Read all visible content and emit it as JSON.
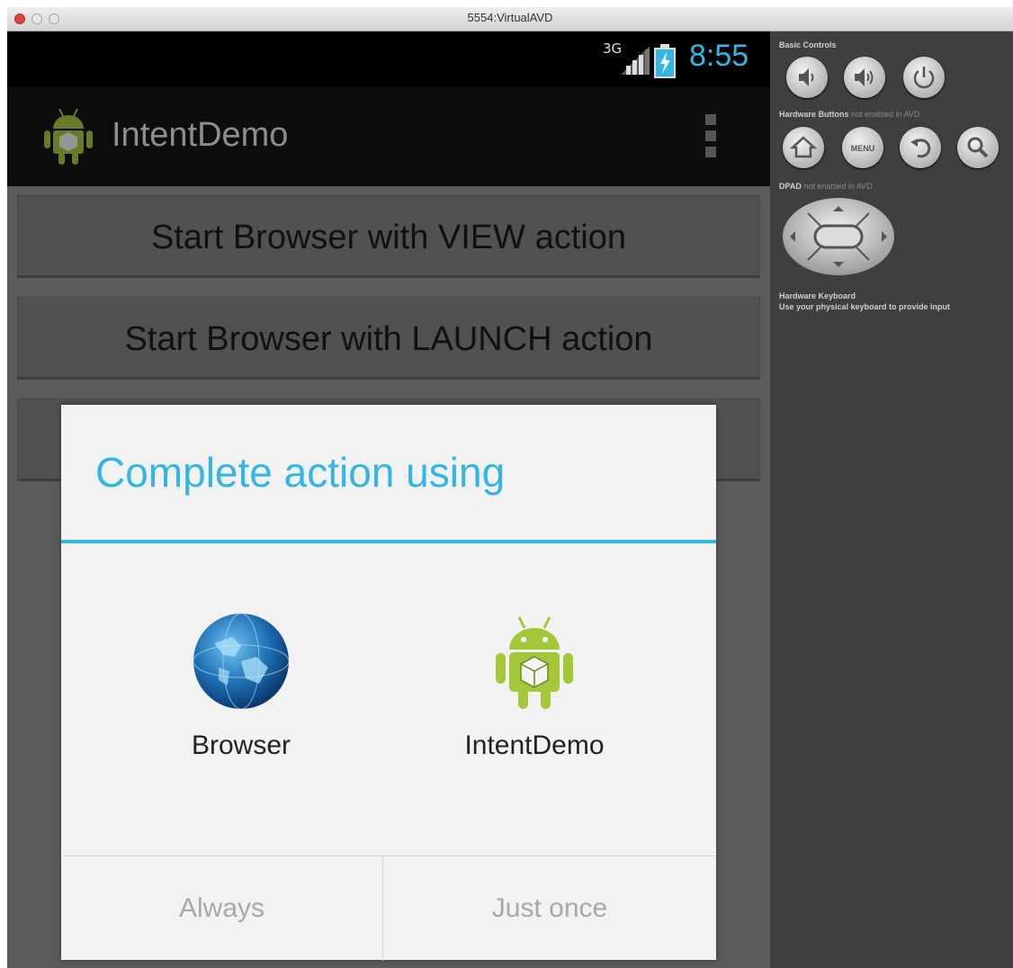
{
  "window": {
    "title": "5554:VirtualAVD"
  },
  "status_bar": {
    "network": "3G",
    "time": "8:55"
  },
  "action_bar": {
    "app_title": "IntentDemo"
  },
  "app_buttons": [
    {
      "label": "Start Browser with VIEW action"
    },
    {
      "label": "Start Browser with LAUNCH action"
    },
    {
      "label": ""
    }
  ],
  "dialog": {
    "title": "Complete action using",
    "choices": [
      {
        "label": "Browser",
        "icon": "browser-globe-icon"
      },
      {
        "label": "IntentDemo",
        "icon": "android-app-icon"
      }
    ],
    "buttons": {
      "always": "Always",
      "just_once": "Just once"
    }
  },
  "emulator_controls": {
    "basic_controls": "Basic Controls",
    "hardware_buttons": "Hardware Buttons",
    "hardware_buttons_note": "not enabled in AVD",
    "dpad": "DPAD",
    "dpad_note": "not enabled in AVD",
    "keyboard": "Hardware Keyboard",
    "keyboard_note": "Use your physical keyboard to provide input",
    "menu_label": "MENU"
  },
  "colors": {
    "accent": "#33b5e5",
    "dialog_bg": "#f2f2f2",
    "android_green": "#a4c639"
  }
}
